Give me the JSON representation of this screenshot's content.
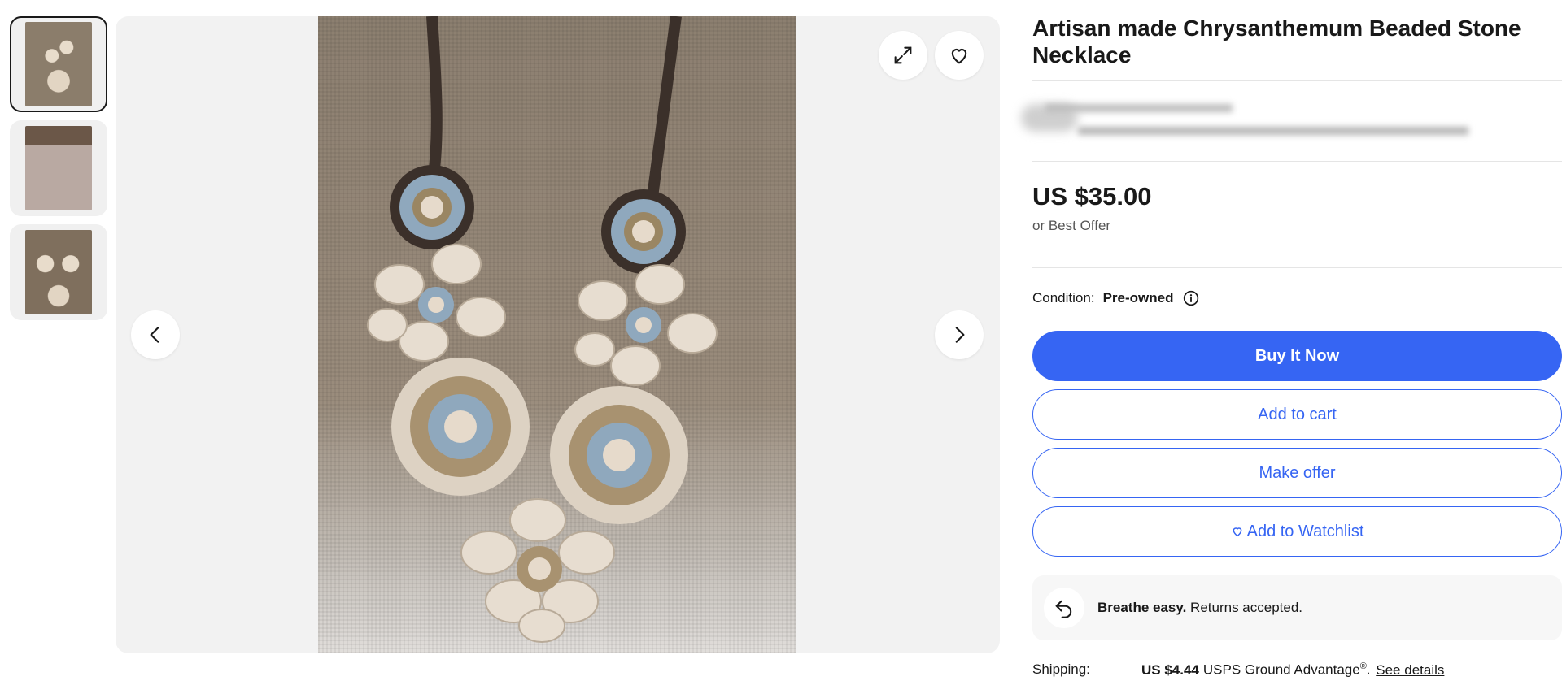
{
  "listing": {
    "title": "Artisan made Chrysanthemum Beaded Stone Necklace",
    "price": "US $35.00",
    "best_offer": "or Best Offer",
    "condition_label": "Condition:",
    "condition_value": "Pre-owned"
  },
  "gallery": {
    "thumbnails": [
      {
        "name": "thumbnail-1",
        "active": true
      },
      {
        "name": "thumbnail-2",
        "active": false
      },
      {
        "name": "thumbnail-3",
        "active": false
      }
    ],
    "icons": {
      "expand": "expand-icon",
      "heart": "heart-icon",
      "prev": "chevron-left-icon",
      "next": "chevron-right-icon"
    }
  },
  "actions": {
    "buy_now": "Buy It Now",
    "add_to_cart": "Add to cart",
    "make_offer": "Make offer",
    "add_to_watchlist": "Add to Watchlist"
  },
  "returns": {
    "headline": "Breathe easy.",
    "detail": "Returns accepted."
  },
  "shipping": {
    "label": "Shipping:",
    "price": "US $4.44",
    "service": "USPS Ground Advantage",
    "trademark": "®",
    "separator": ".",
    "details_link": "See details"
  },
  "colors": {
    "primary": "#3665f3",
    "text": "#191919",
    "muted": "#555555",
    "surface": "#f2f2f2"
  }
}
